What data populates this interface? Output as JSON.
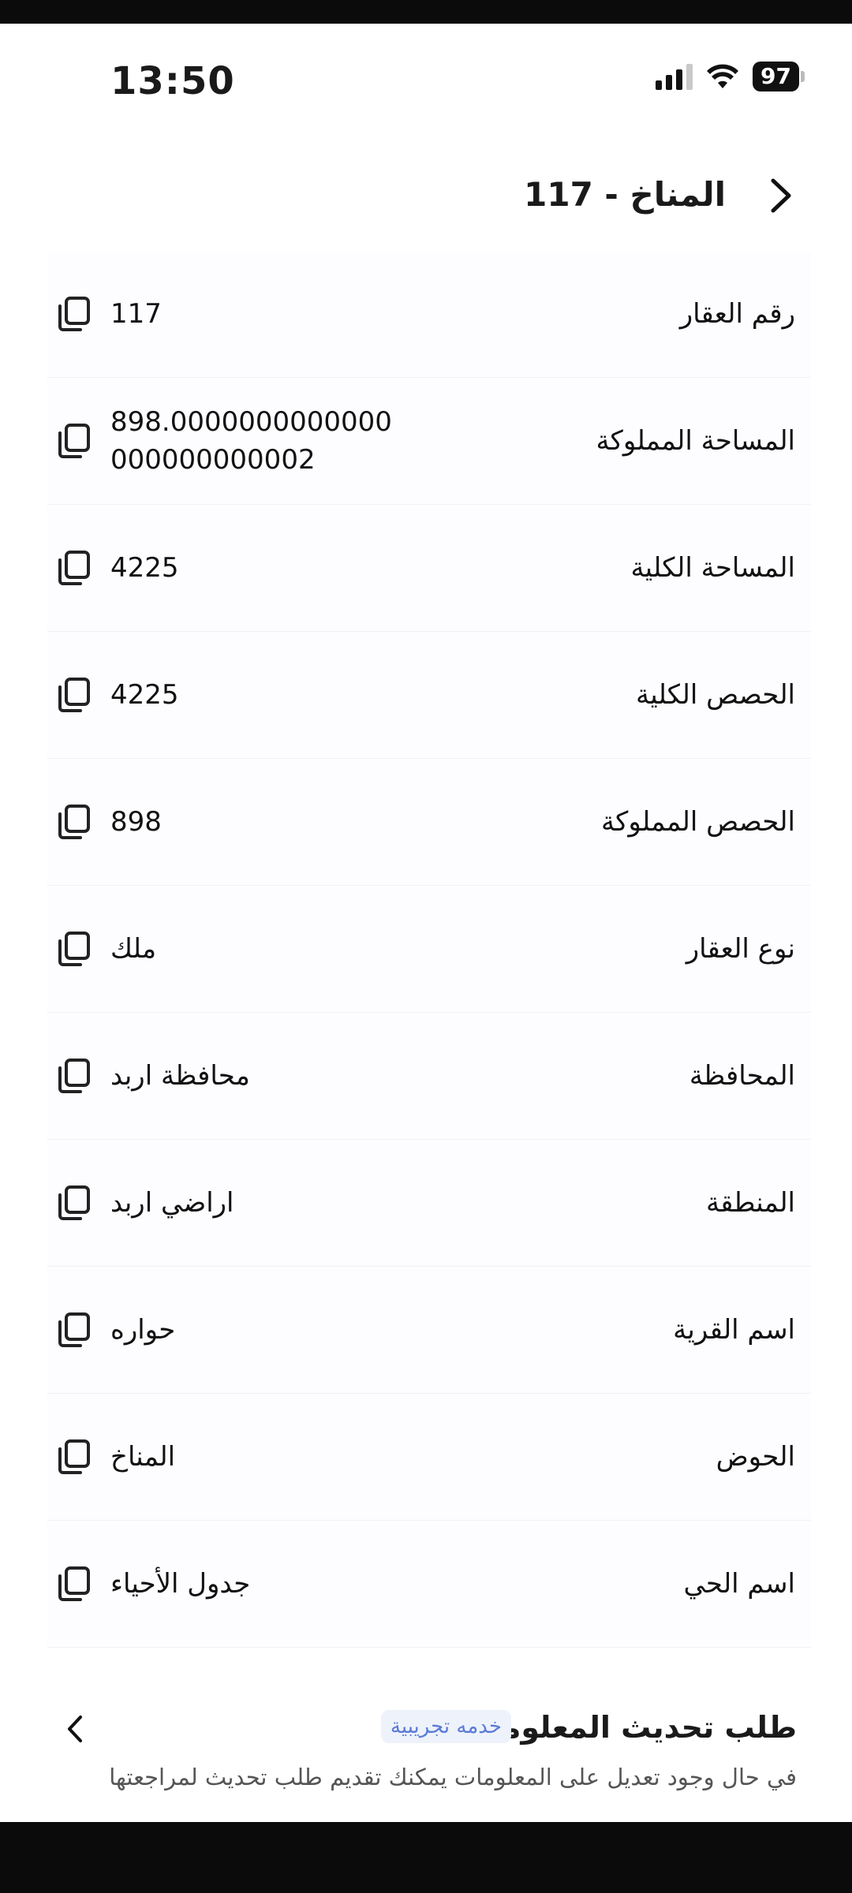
{
  "status_bar": {
    "time": "13:50",
    "battery": "97",
    "icons": [
      "signal-icon",
      "wifi-icon",
      "battery-icon"
    ]
  },
  "header": {
    "title": "المناخ - 117",
    "back_icon": "chevron-right-icon"
  },
  "fields": [
    {
      "label": "رقم العقار",
      "value": "117"
    },
    {
      "label": "المساحة المملوكة",
      "value_line1": "898.0000000000000",
      "value_line2": "000000000002"
    },
    {
      "label": "المساحة الكلية",
      "value": "4225"
    },
    {
      "label": "الحصص الكلية",
      "value": "4225"
    },
    {
      "label": "الحصص المملوكة",
      "value": "898"
    },
    {
      "label": "نوع العقار",
      "value": "ملك"
    },
    {
      "label": "المحافظة",
      "value": "محافظة اربد"
    },
    {
      "label": "المنطقة",
      "value": "اراضي اربد"
    },
    {
      "label": "اسم القرية",
      "value": "حواره"
    },
    {
      "label": "الحوض",
      "value": "المناخ"
    },
    {
      "label": "اسم الحي",
      "value": "جدول الأحياء"
    }
  ],
  "update_request": {
    "title": "طلب تحديث المعلومات",
    "badge": "خدمه تجريبية",
    "description": "في حال وجود تعديل على المعلومات يمكنك تقديم طلب تحديث لمراجعتها"
  },
  "colors": {
    "badge_bg": "#eef2fb",
    "badge_text": "#5a7bd6",
    "row_bg": "#fdfdff"
  }
}
